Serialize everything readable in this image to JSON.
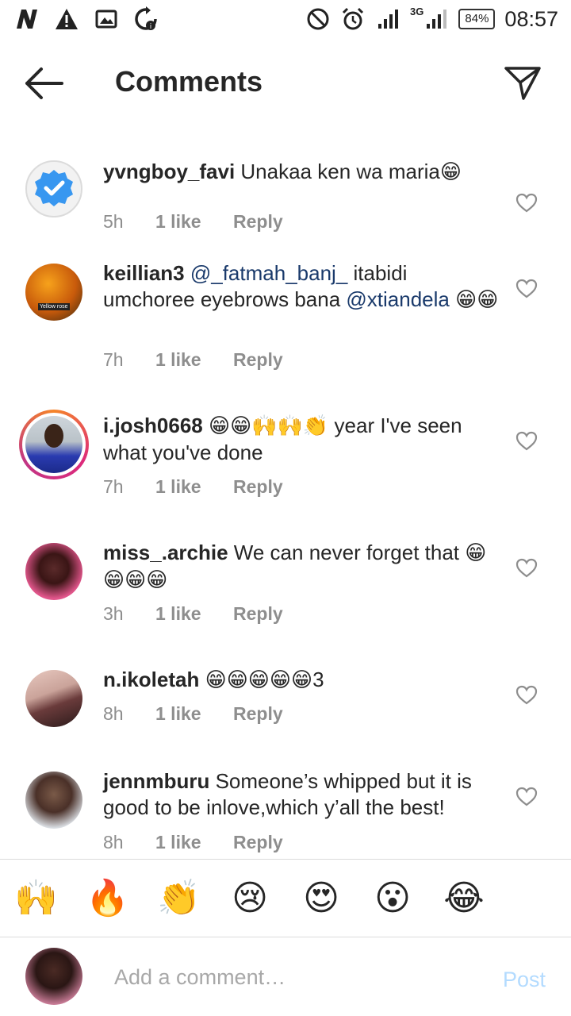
{
  "status_bar": {
    "left_icons": [
      "n-app-icon",
      "warning-icon",
      "image-icon",
      "sync-icon"
    ],
    "right_icons": [
      "do-not-disturb-icon",
      "alarm-icon",
      "signal-icon",
      "signal-3g-icon"
    ],
    "network_type": "3G",
    "battery": "84%",
    "time": "08:57"
  },
  "header": {
    "title": "Comments"
  },
  "comments": [
    {
      "username": "yvngboy_favi",
      "text": "Unakaa ken wa maria",
      "emojis": "😁",
      "time": "5h",
      "likes": "1 like",
      "reply": "Reply"
    },
    {
      "username": "keillian3",
      "mention1": "@_fatmah_banj_",
      "text1": " itabidi umchoree eyebrows bana ",
      "mention2": "@xtiandela",
      "emojis": "😁😁",
      "time": "7h",
      "likes": "1 like",
      "reply": "Reply",
      "avatar_caption": "Yellow rose"
    },
    {
      "username": "i.josh0668",
      "emojis": "😁😁🙌🙌👏",
      "text": " year I've seen what you've done",
      "time": "7h",
      "likes": "1 like",
      "reply": "Reply"
    },
    {
      "username": "miss_.archie",
      "text": "We can never forget that",
      "emojis": "😁😁😁😁",
      "time": "3h",
      "likes": "1 like",
      "reply": "Reply"
    },
    {
      "username": "n.ikoletah",
      "emojis": "😁😁😁😁😁",
      "text": "3",
      "time": "8h",
      "likes": "1 like",
      "reply": "Reply"
    },
    {
      "username": "jennmburu",
      "text": "Someone’s whipped but it is good to be inlove,which y’all the best!",
      "time": "8h",
      "likes": "1 like",
      "reply": "Reply"
    }
  ],
  "emoji_bar": [
    "🙌",
    "🔥",
    "👏",
    "😢",
    "😍",
    "😮",
    "😂"
  ],
  "composer": {
    "placeholder": "Add a comment…",
    "post_label": "Post"
  },
  "colors": {
    "mention": "#1a3a6b",
    "post_disabled": "#b3dbff",
    "meta_gray": "#8e8e8e"
  }
}
